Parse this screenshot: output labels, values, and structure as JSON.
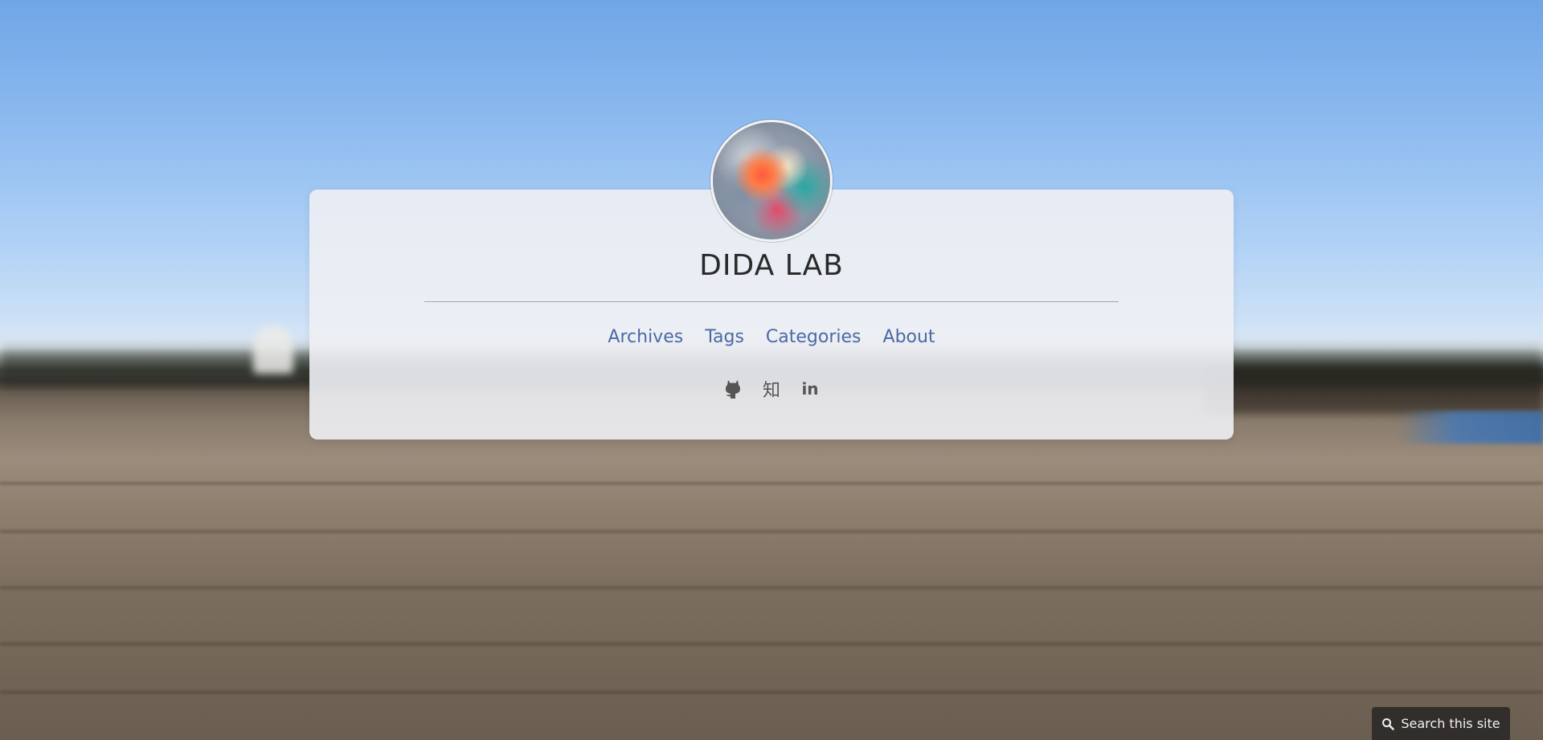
{
  "site": {
    "title": "DIDA LAB"
  },
  "nav": {
    "items": [
      {
        "label": "Archives"
      },
      {
        "label": "Tags"
      },
      {
        "label": "Categories"
      },
      {
        "label": "About"
      }
    ]
  },
  "social": {
    "icons": [
      "github-icon",
      "zhihu-icon",
      "linkedin-icon"
    ],
    "zhihu_glyph": "知",
    "linkedin_glyph": "in"
  },
  "search": {
    "label": "Search this site",
    "icon": "search-icon"
  },
  "colors": {
    "link": "#4a6aa5",
    "title": "#2a2a2a",
    "icon": "#555555"
  }
}
